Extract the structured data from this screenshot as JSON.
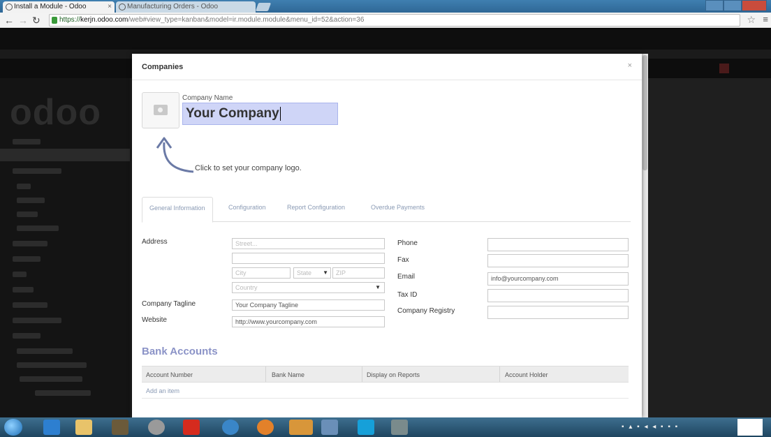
{
  "browser": {
    "tabs": [
      {
        "title": "Install a Module - Odoo"
      },
      {
        "title": "Manufacturing Orders - Odoo"
      }
    ],
    "url": {
      "scheme": "https://",
      "host": "kerjn.odoo.com",
      "path": "/web#view_type=kanban&model=ir.module.module&menu_id=52&action=36"
    }
  },
  "modal": {
    "title": "Companies",
    "close": "×",
    "company_name_label": "Company Name",
    "company_name_value": "Your Company",
    "logo_hint": "Click to set your company logo.",
    "tabs": [
      {
        "label": "General Information",
        "active": true
      },
      {
        "label": "Configuration"
      },
      {
        "label": "Report Configuration"
      },
      {
        "label": "Overdue Payments"
      }
    ],
    "left_fields": {
      "address_label": "Address",
      "street_placeholder": "Street...",
      "street2_placeholder": "",
      "city_placeholder": "City",
      "state_placeholder": "State",
      "zip_placeholder": "ZIP",
      "country_placeholder": "Country",
      "tagline_label": "Company Tagline",
      "tagline_value": "Your Company Tagline",
      "website_label": "Website",
      "website_value": "http://www.yourcompany.com"
    },
    "right_fields": {
      "phone_label": "Phone",
      "phone_value": "",
      "fax_label": "Fax",
      "fax_value": "",
      "email_label": "Email",
      "email_value": "info@yourcompany.com",
      "taxid_label": "Tax ID",
      "taxid_value": "",
      "registry_label": "Company Registry",
      "registry_value": ""
    },
    "bank_accounts": {
      "title": "Bank Accounts",
      "columns": [
        "Account Number",
        "Bank Name",
        "Display on Reports",
        "Account Holder"
      ],
      "add_item": "Add an item"
    }
  },
  "colors": {
    "highlight": "#cfd5f7",
    "accent": "#8b93c7",
    "link": "#8a9ab4"
  },
  "icons": [
    "camera-icon",
    "up-arrow-icon",
    "dropdown-caret-icon",
    "close-icon",
    "lock-icon",
    "star-icon"
  ]
}
